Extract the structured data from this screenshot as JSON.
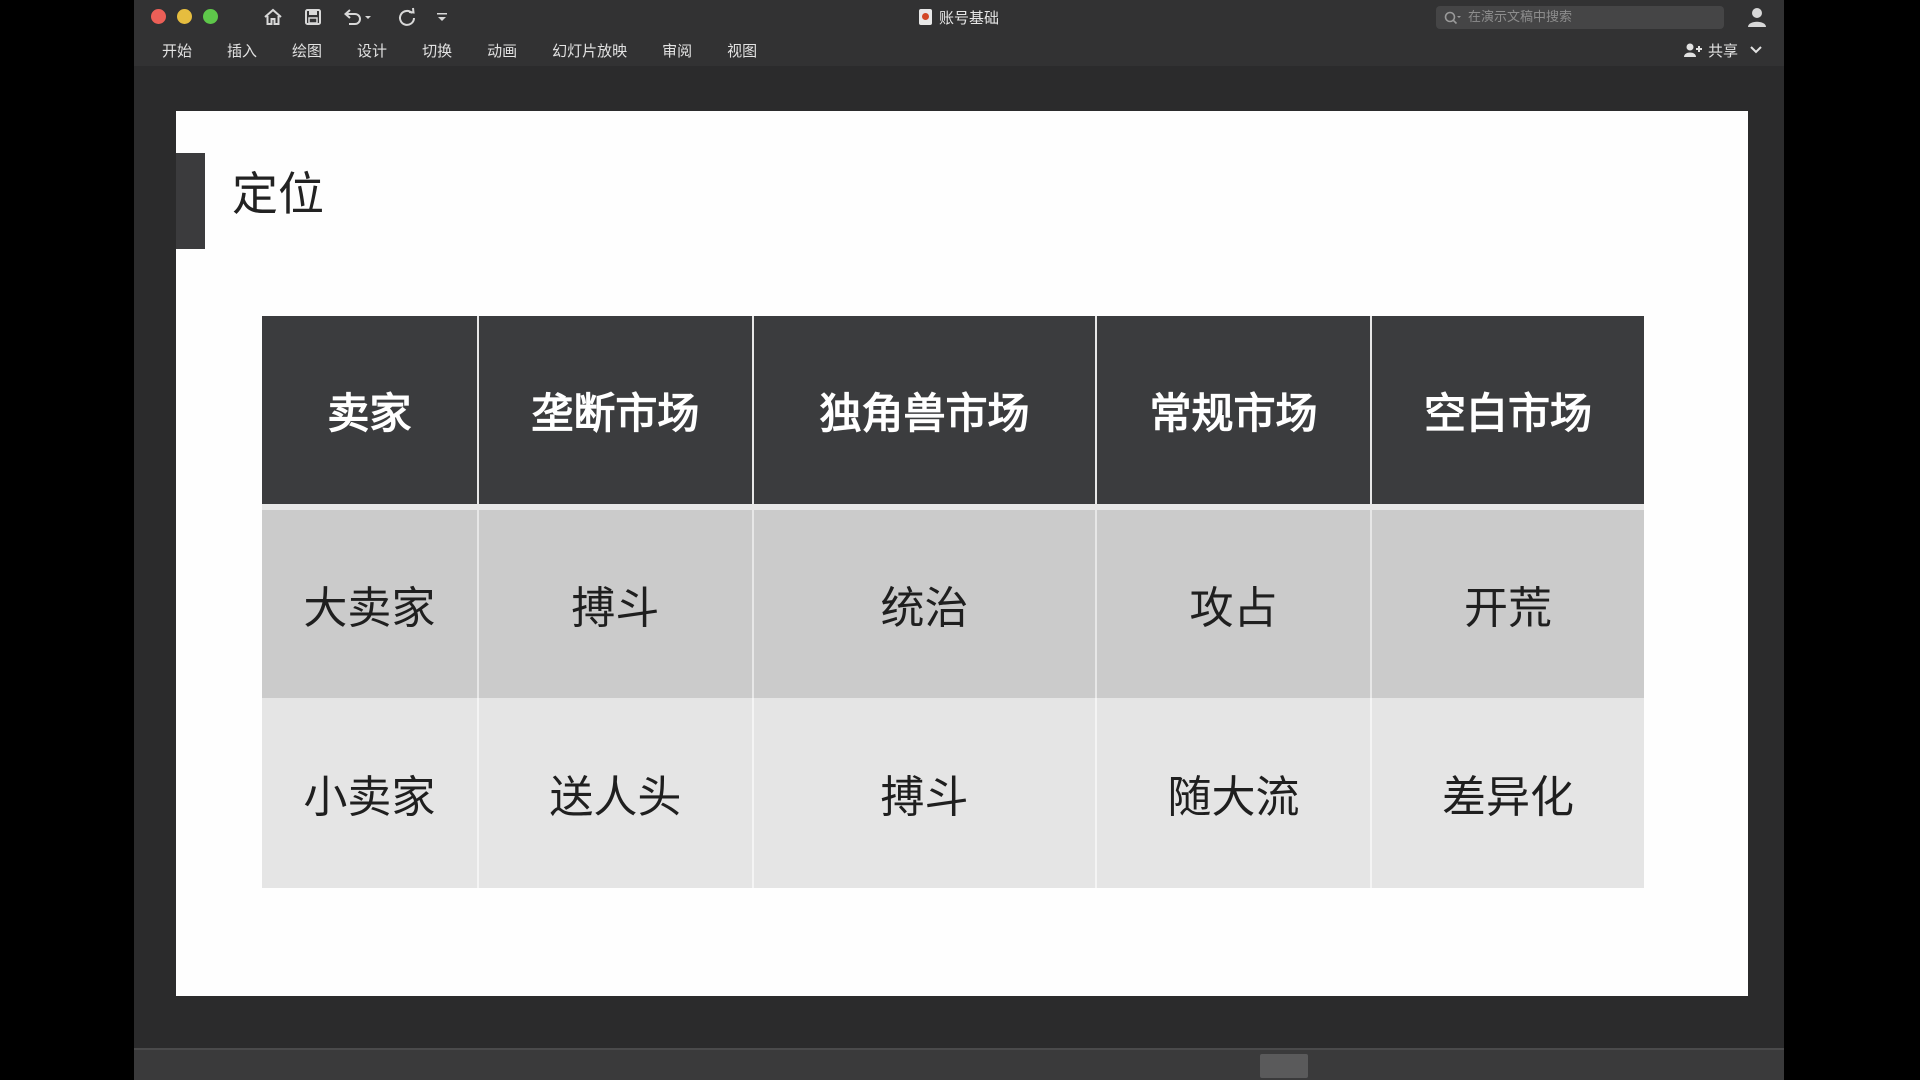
{
  "window": {
    "doc_title": "账号基础",
    "search_placeholder": "在演示文稿中搜索"
  },
  "ribbon": {
    "tabs": [
      "开始",
      "插入",
      "绘图",
      "设计",
      "切换",
      "动画",
      "幻灯片放映",
      "审阅",
      "视图"
    ],
    "share_label": "共享"
  },
  "slide": {
    "title": "定位",
    "table": {
      "headers": [
        "卖家",
        "垄断市场",
        "独角兽市场",
        "常规市场",
        "空白市场"
      ],
      "rows": [
        [
          "大卖家",
          "搏斗",
          "统治",
          "攻占",
          "开荒"
        ],
        [
          "小卖家",
          "送人头",
          "搏斗",
          "随大流",
          "差异化"
        ]
      ]
    }
  },
  "colors": {
    "header_bg": "#3b3c3e",
    "row1_bg": "#cbcbcb",
    "row2_bg": "#e5e5e5",
    "close": "#ec5f57",
    "minimize": "#e6bd3f",
    "zoom": "#5ec74a"
  }
}
